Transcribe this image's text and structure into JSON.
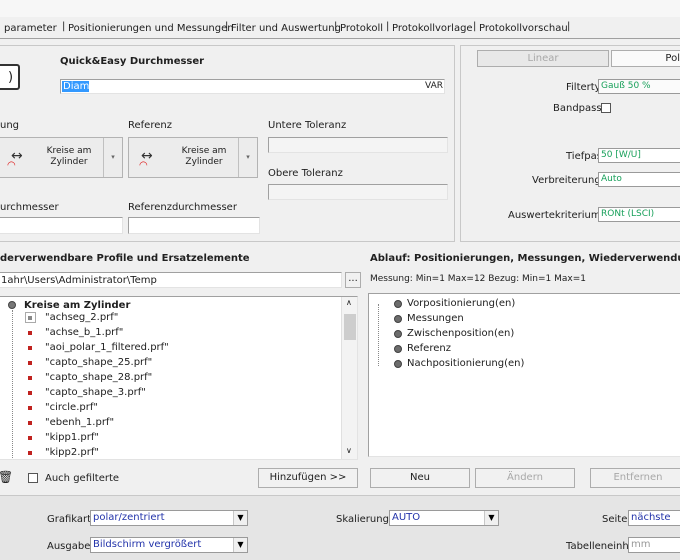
{
  "tabs": [
    "parameter",
    "Positionierungen und Messungen",
    "Filter und Auswertung",
    "Protokoll",
    "Protokollvorlage",
    "Protokollvorschau"
  ],
  "element": {
    "title": "Quick&Easy Durchmesser",
    "name_value": "Diam",
    "var_button": "VAR"
  },
  "labels": {
    "messung_trunc": "ung",
    "referenz": "Referenz",
    "untere_toleranz": "Untere Toleranz",
    "obere_toleranz": "Obere Toleranz",
    "durchmesser_trunc": "urchmesser",
    "referenzdurchmesser": "Referenzdurchmesser"
  },
  "profile_selectors": {
    "left_label": "Kreise am Zylinder",
    "right_label": "Kreise am Zylinder"
  },
  "filter": {
    "linear_tab": "Linear",
    "polar_tab": "Pol",
    "filtertyp_label": "Filtertyp",
    "filtertyp_value": "Gauß 50 %",
    "bandpass_label": "Bandpass",
    "tiefpass_label": "Tiefpass",
    "tiefpass_value": "50 [W/U]",
    "verbreiterung_label": "Verbreiterung",
    "verbreiterung_value": "Auto",
    "auswertekriterium_label": "Auswertekriterium",
    "auswertekriterium_value": "RONt (LSCI)"
  },
  "profiles": {
    "heading": "derverwendbare Profile und Ersatzelemente",
    "path": "1ahr\\Users\\Administrator\\Temp",
    "browse": "...",
    "root": "Kreise am Zylinder",
    "files": [
      "\"achseg_2.prf\"",
      "\"achse_b_1.prf\"",
      "\"aoi_polar_1_filtered.prf\"",
      "\"capto_shape_25.prf\"",
      "\"capto_shape_28.prf\"",
      "\"capto_shape_3.prf\"",
      "\"circle.prf\"",
      "\"ebenh_1.prf\"",
      "\"kipp1.prf\"",
      "\"kipp2.prf\""
    ],
    "auch_gefilterte": "Auch gefilterte",
    "hinzufuegen": "Hinzufügen >>"
  },
  "ablauf": {
    "heading": "Ablauf: Positionierungen, Messungen, Wiederverwendun",
    "info": "Messung: Min=1 Max=12   Bezug: Min=1 Max=1",
    "items": [
      "Vorpositionierung(en)",
      "Messungen",
      "Zwischenposition(en)",
      "Referenz",
      "Nachpositionierung(en)"
    ],
    "neu": "Neu",
    "aendern": "Ändern",
    "entfernen": "Entfernen"
  },
  "bottom": {
    "grafikart_label": "Grafikart",
    "grafikart_value": "polar/zentriert",
    "skalierung_label": "Skalierung",
    "skalierung_value": "AUTO",
    "seite_label": "Seite",
    "seite_value": "nächste",
    "ausgabe_label": "Ausgabe",
    "ausgabe_value": "Bildschirm vergrößert",
    "tabelleneinheit_label": "Tabelleneinheit",
    "tabelleneinheit_value": "mm"
  },
  "colors": {
    "value_text": "#2233aa",
    "selection": "#3399ff",
    "bullet_red": "#c0221f"
  }
}
